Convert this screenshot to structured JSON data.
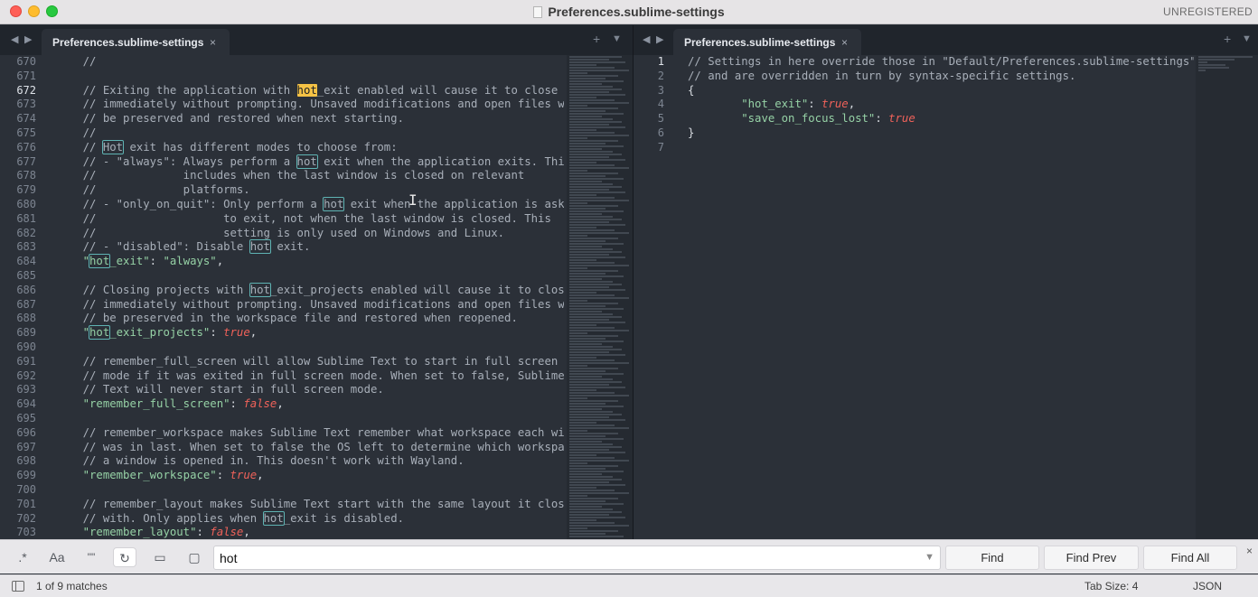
{
  "window": {
    "title": "Preferences.sublime-settings",
    "registration": "UNREGISTERED"
  },
  "left_tab": {
    "label": "Preferences.sublime-settings",
    "close": "×"
  },
  "right_tab": {
    "label": "Preferences.sublime-settings",
    "close": "×"
  },
  "tab_controls": {
    "back": "◀",
    "forward": "▶",
    "plus": "+",
    "menu": "▼"
  },
  "left_editor": {
    "active_line": 672,
    "line_numbers": [
      "670",
      "671",
      "672",
      "673",
      "674",
      "675",
      "676",
      "677",
      "678",
      "679",
      "680",
      "681",
      "682",
      "683",
      "684",
      "685",
      "686",
      "687",
      "688",
      "689",
      "690",
      "691",
      "692",
      "693",
      "694",
      "695",
      "696",
      "697",
      "698",
      "699",
      "700",
      "701",
      "702",
      "703"
    ],
    "lines": [
      "    //",
      "",
      "    // Exiting the application with hot_exit enabled will cause it to close",
      "    // immediately without prompting. Unsaved modifications and open files w",
      "    // be preserved and restored when next starting.",
      "    //",
      "    // Hot exit has different modes to choose from:",
      "    // - \"always\": Always perform a hot exit when the application exits. Thi",
      "    //             includes when the last window is closed on relevant",
      "    //             platforms.",
      "    // - \"only_on_quit\": Only perform a hot exit when the application is aske",
      "    //                   to exit, not when the last window is closed. This",
      "    //                   setting is only used on Windows and Linux.",
      "    // - \"disabled\": Disable hot exit.",
      "    \"hot_exit\": \"always\",",
      "",
      "    // Closing projects with hot_exit_projects enabled will cause it to close",
      "    // immediately without prompting. Unsaved modifications and open files w",
      "    // be preserved in the workspace file and restored when reopened.",
      "    \"hot_exit_projects\": true,",
      "",
      "    // remember_full_screen will allow Sublime Text to start in full screen",
      "    // mode if it was exited in full screen mode. When set to false, Sublime",
      "    // Text will never start in full screen mode.",
      "    \"remember_full_screen\": false,",
      "",
      "    // remember_workspace makes Sublime Text remember what workspace each wi",
      "    // was in last. When set to false the OS left to determine which workspa",
      "    // a window is opened in. This doesn't work with Wayland.",
      "    \"remember_workspace\": true,",
      "",
      "    // remember_layout makes Sublime Text start with the same layout it clos",
      "    // with. Only applies when hot_exit is disabled.",
      "    \"remember_layout\": false,"
    ]
  },
  "right_editor": {
    "active_line": 1,
    "line_numbers": [
      "1",
      "2",
      "3",
      "4",
      "5",
      "6",
      "7"
    ],
    "lines": [
      "// Settings in here override those in \"Default/Preferences.sublime-settings\",",
      "// and are overridden in turn by syntax-specific settings.",
      "{",
      "        \"hot_exit\": true,",
      "        \"save_on_focus_lost\": true",
      "}",
      ""
    ]
  },
  "find": {
    "options": {
      "regex": ".*",
      "case": "Aa",
      "whole_word": "\"\"",
      "wrap": "↻",
      "in_selection": "▭",
      "highlight": "▢"
    },
    "query": "hot",
    "find_label": "Find",
    "find_prev_label": "Find Prev",
    "find_all_label": "Find All",
    "dropdown": "▼",
    "close": "×"
  },
  "status": {
    "matches": "1 of 9 matches",
    "tab_size": "Tab Size: 4",
    "syntax": "JSON"
  },
  "colors": {
    "editor_bg": "#2b3038",
    "comment": "#a8afb9",
    "string": "#96d2a6",
    "keyword": "#f1625a",
    "match_outline": "#5fb3b3",
    "current_match": "#f5c245"
  }
}
